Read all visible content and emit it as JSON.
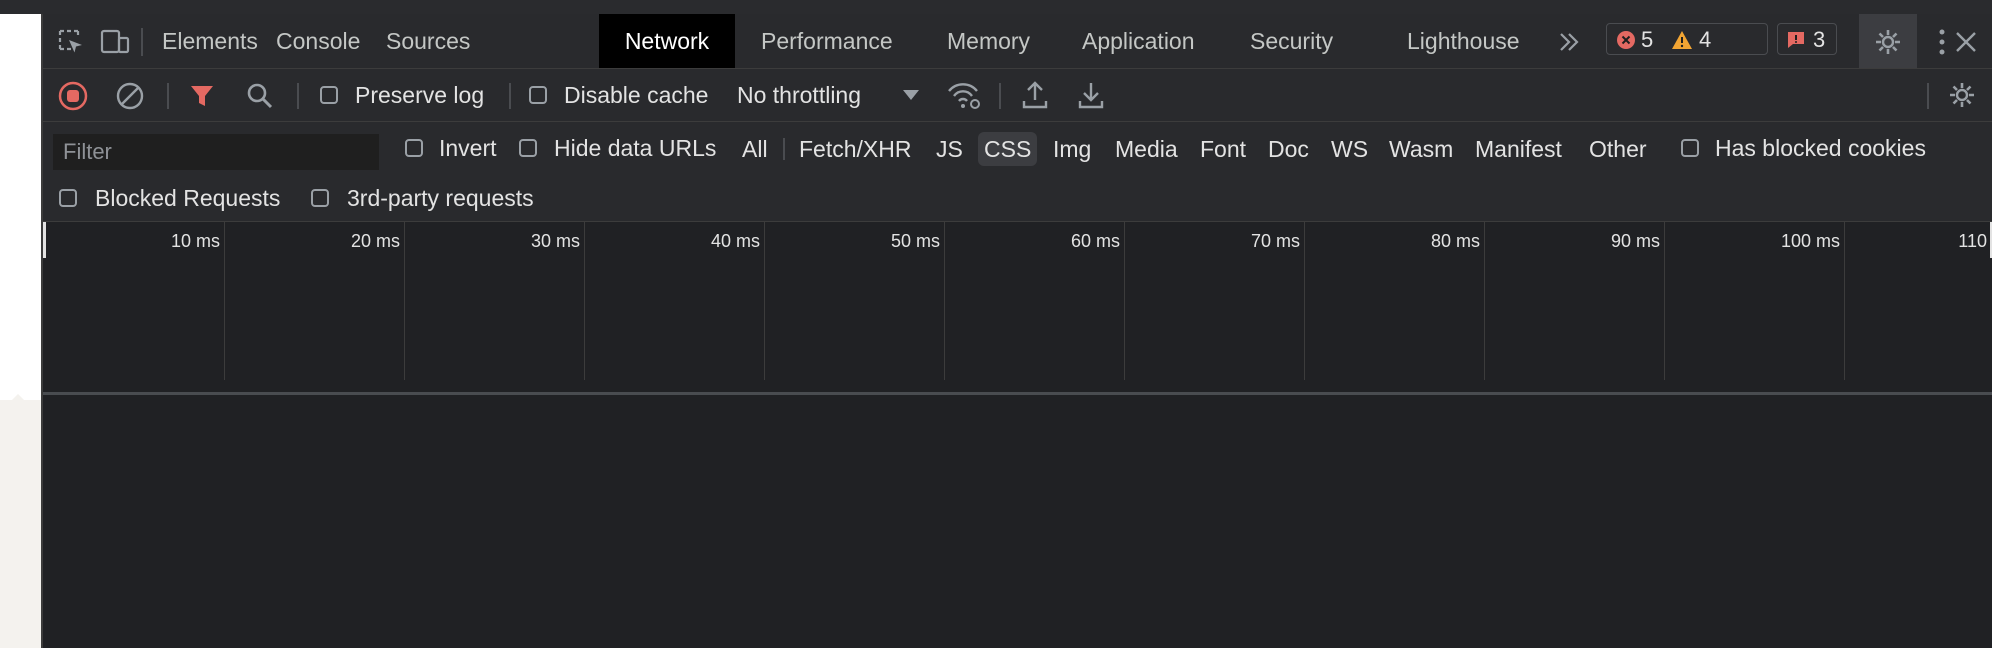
{
  "tabs": [
    {
      "label": "Elements"
    },
    {
      "label": "Console"
    },
    {
      "label": "Sources"
    },
    {
      "label": "Network"
    },
    {
      "label": "Performance"
    },
    {
      "label": "Memory"
    },
    {
      "label": "Application"
    },
    {
      "label": "Security"
    },
    {
      "label": "Lighthouse"
    }
  ],
  "more_tabs_icon": "double-chevron-right",
  "badges": {
    "errors": "5",
    "warnings": "4",
    "issues": "3"
  },
  "toolbar": {
    "preserve_log": "Preserve log",
    "disable_cache": "Disable cache",
    "throttling": "No throttling"
  },
  "filter": {
    "placeholder": "Filter",
    "invert": "Invert",
    "hide_data_urls": "Hide data URLs",
    "types": [
      "All",
      "Fetch/XHR",
      "JS",
      "CSS",
      "Img",
      "Media",
      "Font",
      "Doc",
      "WS",
      "Wasm",
      "Manifest",
      "Other"
    ],
    "active_type": "CSS",
    "has_blocked_cookies": "Has blocked cookies",
    "blocked_requests": "Blocked Requests",
    "third_party": "3rd-party requests"
  },
  "timeline": {
    "ticks": [
      "10 ms",
      "20 ms",
      "30 ms",
      "40 ms",
      "50 ms",
      "60 ms",
      "70 ms",
      "80 ms",
      "90 ms",
      "100 ms",
      "110"
    ]
  },
  "colors": {
    "record_red": "#e46962",
    "error_red": "#e46962",
    "warning_yellow": "#f2a533",
    "panel_bg": "#202124",
    "toolbar_bg": "#292a2d",
    "active_tab_bg": "#000000"
  }
}
